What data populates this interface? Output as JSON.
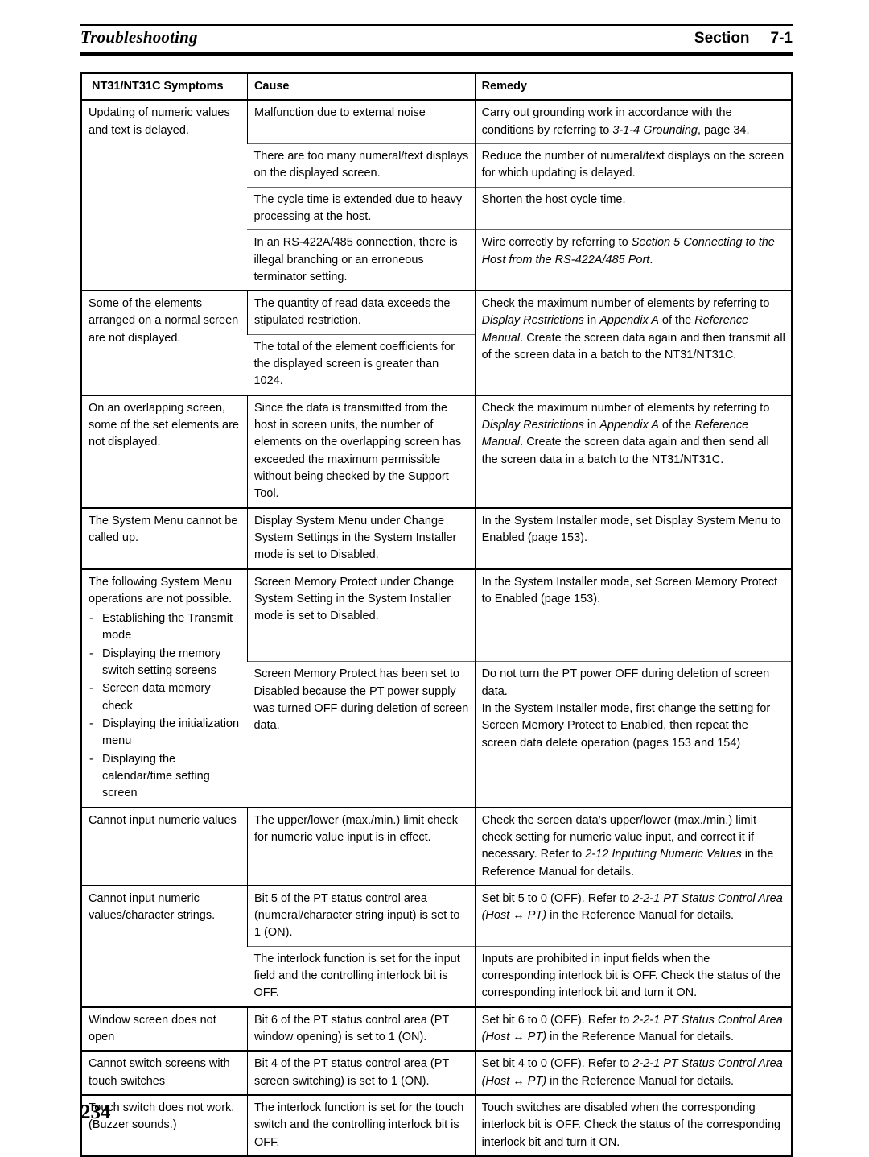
{
  "header": {
    "title": "Troubleshooting",
    "section_label": "Section",
    "section_number": "7-1"
  },
  "table": {
    "columns": [
      "NT31/NT31C Symptoms",
      "Cause",
      "Remedy"
    ],
    "groups": [
      {
        "symptom": "Updating of numeric values and text is delayed.",
        "rows": [
          {
            "cause": "Malfunction due to external noise",
            "remedy_parts": [
              {
                "text": "Carry out grounding work in accordance with the conditions by referring to ",
                "italic": false
              },
              {
                "text": "3-1-4 Grounding",
                "italic": true
              },
              {
                "text": ", page 34.",
                "italic": false
              }
            ]
          },
          {
            "cause": "There are too many numeral/text displays on the displayed screen.",
            "remedy_parts": [
              {
                "text": "Reduce the number of numeral/text displays on the screen for which updating is delayed.",
                "italic": false
              }
            ]
          },
          {
            "cause": "The cycle time is extended due to heavy processing at the host.",
            "remedy_parts": [
              {
                "text": "Shorten the host cycle time.",
                "italic": false
              }
            ]
          },
          {
            "cause": "In an RS-422A/485 connection, there is illegal branching or an erroneous terminator setting.",
            "remedy_parts": [
              {
                "text": "Wire correctly by referring to ",
                "italic": false
              },
              {
                "text": "Section 5 Connecting to the Host from the RS-422A/485 Port",
                "italic": true
              },
              {
                "text": ".",
                "italic": false
              }
            ]
          }
        ]
      },
      {
        "symptom": "Some of the elements arranged on a normal screen are not displayed.",
        "rows": [
          {
            "cause": "The quantity of read data exceeds the stipulated restriction.",
            "remedy_rowspan": 2,
            "remedy_parts": [
              {
                "text": "Check the maximum number of elements by referring to ",
                "italic": false
              },
              {
                "text": "Display Restrictions",
                "italic": true
              },
              {
                "text": " in ",
                "italic": false
              },
              {
                "text": "Appendix A",
                "italic": true
              },
              {
                "text": " of the ",
                "italic": false
              },
              {
                "text": "Reference Manual",
                "italic": true
              },
              {
                "text": ". Create the screen data again and then transmit all of the screen data in a batch to the NT31/NT31C.",
                "italic": false
              }
            ]
          },
          {
            "cause": "The total of the element coefficients for the displayed screen is greater than 1024."
          }
        ]
      },
      {
        "symptom": "On an overlapping screen, some of the set elements are not displayed.",
        "rows": [
          {
            "cause": "Since the data is transmitted from the host in screen units, the number of elements on the overlapping screen has exceeded the maximum permissible without being checked by the Support Tool.",
            "remedy_parts": [
              {
                "text": "Check the maximum number of elements by referring to ",
                "italic": false
              },
              {
                "text": "Display Restrictions",
                "italic": true
              },
              {
                "text": " in ",
                "italic": false
              },
              {
                "text": "Appendix A",
                "italic": true
              },
              {
                "text": " of the ",
                "italic": false
              },
              {
                "text": "Reference Manual",
                "italic": true
              },
              {
                "text": ". Create the screen data again and then send all the screen data in a batch to the NT31/NT31C.",
                "italic": false
              }
            ]
          }
        ]
      },
      {
        "symptom": "The System Menu cannot be called up.",
        "rows": [
          {
            "cause": "Display System Menu under Change System Settings in the System Installer mode is set to Disabled.",
            "remedy_parts": [
              {
                "text": "In the System Installer mode, set Display System Menu to Enabled (page 153).",
                "italic": false
              }
            ]
          }
        ]
      },
      {
        "symptom": "The following System Menu operations are not possible.",
        "symptom_bullets": [
          "Establishing the Transmit mode",
          "Displaying the memory switch setting screens",
          "Screen data memory check",
          "Displaying the initialization menu",
          "Displaying the calendar/time setting screen"
        ],
        "rows": [
          {
            "cause": "Screen Memory Protect under Change System Setting in the System Installer mode is set to Disabled.",
            "remedy_parts": [
              {
                "text": "In the System Installer mode, set Screen Memory Protect to Enabled (page 153).",
                "italic": false
              }
            ]
          },
          {
            "cause": "Screen Memory Protect has been set to Disabled because the PT power supply was turned OFF during deletion of screen data.",
            "remedy_parts": [
              {
                "text": "Do not turn the PT power OFF during deletion of screen data.",
                "italic": false
              },
              {
                "text": "\n",
                "italic": false
              },
              {
                "text": "In the System Installer mode, first change the setting for Screen Memory Protect to Enabled, then repeat the screen data delete operation (pages 153 and 154)",
                "italic": false
              }
            ]
          }
        ]
      },
      {
        "symptom": "Cannot input numeric values",
        "rows": [
          {
            "cause": "The upper/lower (max./min.) limit check for numeric value input is in effect.",
            "remedy_parts": [
              {
                "text": "Check the screen data’s upper/lower (max./min.) limit check setting for numeric value input, and correct it if necessary. Refer to ",
                "italic": false
              },
              {
                "text": "2-12 Inputting Numeric Values",
                "italic": true
              },
              {
                "text": " in the Reference Manual for details.",
                "italic": false
              }
            ]
          }
        ]
      },
      {
        "symptom": "Cannot input numeric values/character strings.",
        "rows": [
          {
            "cause": "Bit 5 of the PT status control area (numeral/character string input) is set to 1 (ON).",
            "remedy_parts": [
              {
                "text": "Set bit 5 to 0 (OFF). Refer to ",
                "italic": false
              },
              {
                "text": "2-2-1 PT Status Control Area (Host ↔ PT)",
                "italic": true
              },
              {
                "text": " in the Reference Manual for details.",
                "italic": false
              }
            ]
          },
          {
            "cause": "The interlock function is set for the input field and the controlling interlock bit is OFF.",
            "remedy_parts": [
              {
                "text": "Inputs are prohibited in input fields when the corresponding interlock bit is OFF. Check the status of the corresponding interlock bit and turn it ON.",
                "italic": false
              }
            ]
          }
        ]
      },
      {
        "symptom": "Window screen does not open",
        "rows": [
          {
            "cause": "Bit 6 of the PT status control area (PT window opening) is set to 1 (ON).",
            "remedy_parts": [
              {
                "text": "Set bit 6 to 0 (OFF). Refer to ",
                "italic": false
              },
              {
                "text": "2-2-1 PT Status Control Area (Host ↔ PT)",
                "italic": true
              },
              {
                "text": " in the Reference Manual for details.",
                "italic": false
              }
            ]
          }
        ]
      },
      {
        "symptom": "Cannot switch screens with touch switches",
        "rows": [
          {
            "cause": "Bit 4 of the PT status control area (PT screen switching) is set to 1 (ON).",
            "remedy_parts": [
              {
                "text": "Set bit 4 to 0 (OFF). Refer to ",
                "italic": false
              },
              {
                "text": "2-2-1 PT Status Control Area (Host ↔ PT)",
                "italic": true
              },
              {
                "text": " in the Reference Manual for details.",
                "italic": false
              }
            ]
          }
        ]
      },
      {
        "symptom": "Touch switch does not work. (Buzzer sounds.)",
        "rows": [
          {
            "cause": "The interlock function is set for the touch switch and the controlling interlock bit is OFF.",
            "remedy_parts": [
              {
                "text": "Touch switches are disabled when the corresponding interlock bit is OFF. Check the status of the corresponding interlock bit and turn it ON.",
                "italic": false
              }
            ]
          }
        ]
      }
    ]
  },
  "footer": {
    "page_number": "234"
  }
}
